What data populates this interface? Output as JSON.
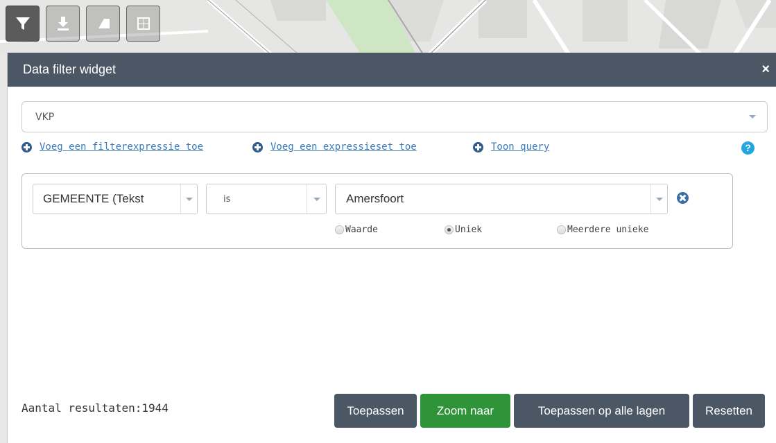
{
  "toolbar": {
    "buttons": [
      {
        "icon": "filter-icon",
        "active": true
      },
      {
        "icon": "download-icon",
        "active": false
      },
      {
        "icon": "back-icon",
        "active": false
      },
      {
        "icon": "grid-icon",
        "active": false
      }
    ]
  },
  "widget": {
    "title": "Data filter widget",
    "close_label": "×",
    "layer": {
      "value": "VKP"
    },
    "links": {
      "add_filter_expression": "Voeg een filterexpressie toe",
      "add_expression_set": "Voeg een expressieset toe",
      "show_query": "Toon query"
    },
    "help_label": "?",
    "expression": {
      "field": "GEMEENTE (Tekst",
      "operator": "is",
      "value": "Amersfoort",
      "value_types": [
        {
          "label": "Waarde",
          "checked": false
        },
        {
          "label": "Uniek",
          "checked": true
        },
        {
          "label": "Meerdere unieke",
          "checked": false
        }
      ]
    },
    "results_label": "Aantal resultaten:1944",
    "buttons": {
      "apply": "Toepassen",
      "zoom": "Zoom naar",
      "apply_all": "Toepassen op alle lagen",
      "reset": "Resetten"
    }
  },
  "colors": {
    "header": "#4c5765",
    "zoom_button": "#2e9339",
    "link": "#3b7ab8",
    "help": "#22a6e0"
  }
}
